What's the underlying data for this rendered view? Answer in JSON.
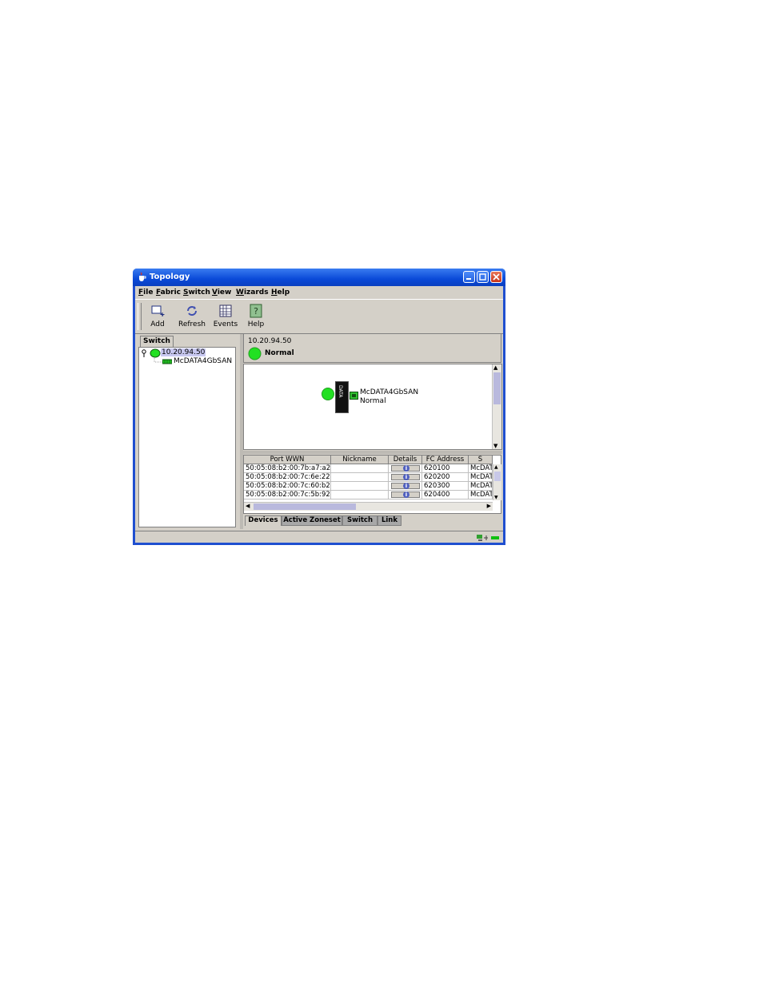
{
  "window": {
    "title": "Topology"
  },
  "menu": [
    {
      "label": "File",
      "mnemonic": "F",
      "rest": "ile"
    },
    {
      "label": "Fabric",
      "mnemonic": "F",
      "rest": "abric"
    },
    {
      "label": "Switch",
      "mnemonic": "S",
      "rest": "witch"
    },
    {
      "label": "View",
      "mnemonic": "V",
      "rest": "iew"
    },
    {
      "label": "Wizards",
      "mnemonic": "W",
      "rest": "izards"
    },
    {
      "label": "Help",
      "mnemonic": "H",
      "rest": "elp"
    }
  ],
  "toolbar": {
    "add": "Add",
    "refresh": "Refresh",
    "events": "Events",
    "help": "Help"
  },
  "left": {
    "tab": "Switch",
    "tree": {
      "root": "10.20.94.50",
      "child": "McDATA4GbSAN"
    }
  },
  "info": {
    "address": "10.20.94.50",
    "status": "Normal"
  },
  "canvas": {
    "switch_name": "McDATA4GbSAN",
    "switch_status": "Normal",
    "chip_text": "DATA"
  },
  "table": {
    "columns": [
      "Port WWN",
      "Nickname",
      "Details",
      "FC Address",
      "S"
    ],
    "rows": [
      {
        "wwn": "50:05:08:b2:00:7b:a7:a2",
        "nick": "",
        "fc": "620100",
        "s": "McDATA"
      },
      {
        "wwn": "50:05:08:b2:00:7c:6e:22",
        "nick": "",
        "fc": "620200",
        "s": "McDATA"
      },
      {
        "wwn": "50:05:08:b2:00:7c:60:b2",
        "nick": "",
        "fc": "620300",
        "s": "McDATA"
      },
      {
        "wwn": "50:05:08:b2:00:7c:5b:92",
        "nick": "",
        "fc": "620400",
        "s": "McDATA"
      }
    ]
  },
  "tabs": [
    "Devices",
    "Active Zoneset",
    "Switch",
    "Link"
  ],
  "colors": {
    "title_bar": "#0a4ad8",
    "status_ok": "#22e022",
    "panel": "#d4d0c8"
  }
}
